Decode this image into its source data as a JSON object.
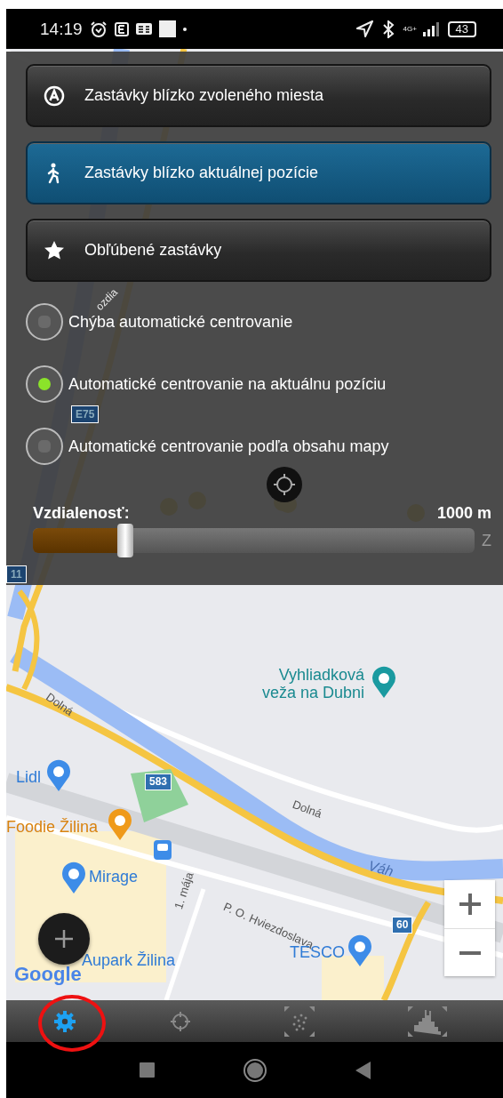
{
  "status_bar": {
    "time": "14:19",
    "network": "4G+",
    "battery": "43"
  },
  "menu_buttons": [
    {
      "kind": "place",
      "label": "Zastávky blízko zvoleného miesta",
      "selected": false
    },
    {
      "kind": "walk",
      "label": "Zastávky blízko aktuálnej pozície",
      "selected": true
    },
    {
      "kind": "star",
      "label": "Obľúbené zastávky",
      "selected": false
    }
  ],
  "centering_options": [
    {
      "label": "Chýba automatické centrovanie",
      "selected": false
    },
    {
      "label": "Automatické centrovanie na aktuálnu pozíciu",
      "selected": true
    },
    {
      "label": "Automatické centrovanie podľa obsahu mapy",
      "selected": false
    }
  ],
  "distance": {
    "label": "Vzdialenosť:",
    "value": "1000 m",
    "level": 0.21,
    "edge_text": "Z"
  },
  "overlay_map_labels": [
    {
      "kind": "road-name",
      "text": "ozdia"
    },
    {
      "kind": "shield",
      "text": "E75"
    },
    {
      "kind": "shield",
      "text": "11"
    }
  ],
  "map_labels": [
    {
      "kind": "road-name",
      "text": "Dolná"
    },
    {
      "kind": "poi-teal",
      "text": "Vyhliadková\nveža na Dubni"
    },
    {
      "kind": "poi-blue",
      "text": "Lidl"
    },
    {
      "kind": "shield",
      "text": "583"
    },
    {
      "kind": "road-name",
      "text": "Dolná"
    },
    {
      "kind": "poi-orange",
      "text": "Foodie Žilina"
    },
    {
      "kind": "poi-blue",
      "text": "Mirage"
    },
    {
      "kind": "river-name",
      "text": "Váh"
    },
    {
      "kind": "road-name",
      "text": "1. mája"
    },
    {
      "kind": "road-name",
      "text": "P. O. Hviezdoslava"
    },
    {
      "kind": "shield",
      "text": "60"
    },
    {
      "kind": "poi-blue",
      "text": "TESCO"
    },
    {
      "kind": "poi-blue",
      "text": "Aupark Žilina"
    },
    {
      "kind": "logo",
      "text": "Google"
    }
  ],
  "bottom_tabs": [
    {
      "kind": "settings",
      "selected": true
    },
    {
      "kind": "locate",
      "selected": false
    },
    {
      "kind": "scatter",
      "selected": false
    },
    {
      "kind": "skyline",
      "selected": false
    }
  ]
}
